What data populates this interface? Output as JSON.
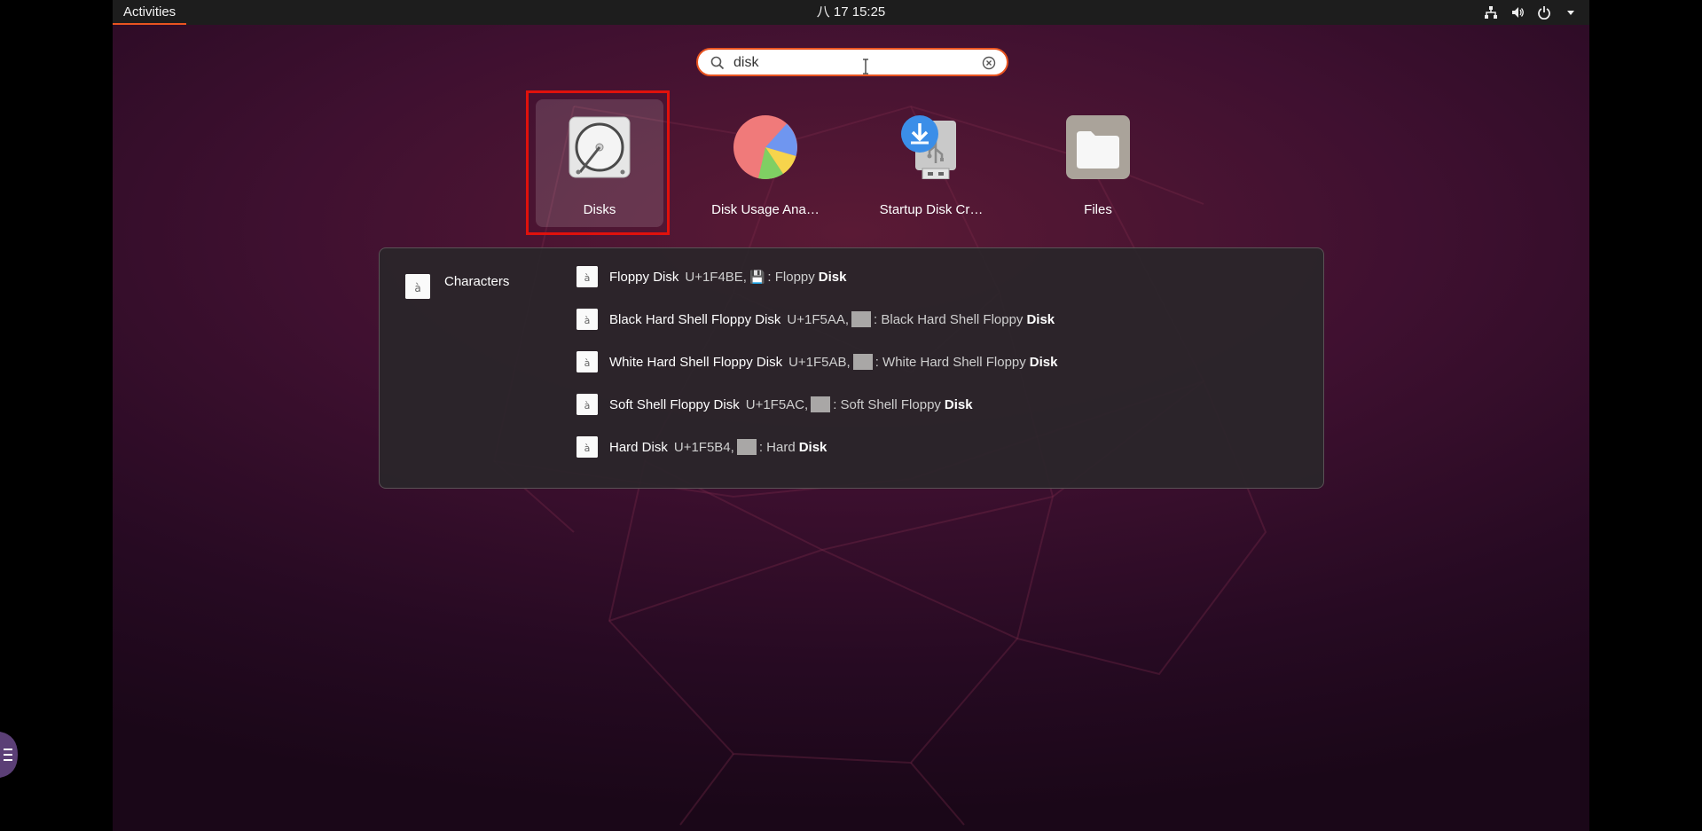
{
  "topbar": {
    "activities_label": "Activities",
    "clock_label": "八 17  15:25",
    "tray_icons": [
      "network-icon",
      "volume-icon",
      "power-icon",
      "system-menu-arrow-icon"
    ]
  },
  "search": {
    "value": "disk",
    "placeholder": ""
  },
  "apps": [
    {
      "label": "Disks",
      "icon": "disks-icon"
    },
    {
      "label": "Disk Usage Ana…",
      "icon": "disk-usage-analyzer-icon"
    },
    {
      "label": "Startup Disk Cr…",
      "icon": "startup-disk-creator-icon"
    },
    {
      "label": "Files",
      "icon": "files-icon"
    }
  ],
  "provider": {
    "label": "Characters",
    "icon": "characters-app-icon"
  },
  "results": [
    {
      "name": "Floppy Disk",
      "code": "U+1F4BE,",
      "glyph": "💾",
      "desc": ": Floppy",
      "bold": "Disk"
    },
    {
      "name": "Black Hard Shell Floppy Disk",
      "code": "U+1F5AA,",
      "glyph": "",
      "desc": ": Black Hard Shell Floppy",
      "bold": "Disk"
    },
    {
      "name": "White Hard Shell Floppy Disk",
      "code": "U+1F5AB,",
      "glyph": "",
      "desc": ": White Hard Shell Floppy",
      "bold": "Disk"
    },
    {
      "name": "Soft Shell Floppy Disk",
      "code": "U+1F5AC,",
      "glyph": "",
      "desc": ": Soft Shell Floppy",
      "bold": "Disk"
    },
    {
      "name": "Hard Disk",
      "code": "U+1F5B4,",
      "glyph": "",
      "desc": ": Hard",
      "bold": "Disk"
    }
  ],
  "colors": {
    "accent": "#e95420",
    "highlight_box": "#e0110c",
    "topbar": "#1d1d1d",
    "results_bg": "#2a262a"
  }
}
